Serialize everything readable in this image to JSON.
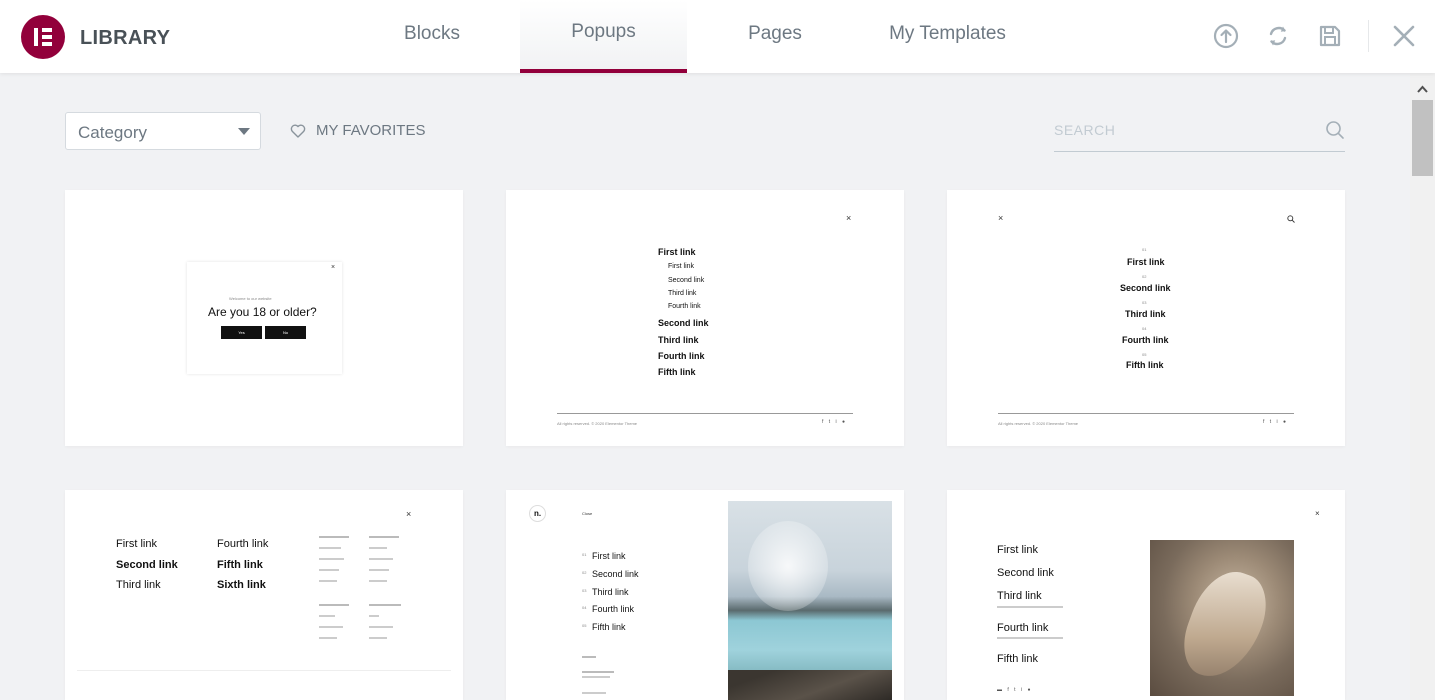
{
  "header": {
    "title": "LIBRARY",
    "tabs": [
      {
        "label": "Blocks",
        "active": false
      },
      {
        "label": "Popups",
        "active": true
      },
      {
        "label": "Pages",
        "active": false
      },
      {
        "label": "My Templates",
        "active": false
      }
    ],
    "icons": [
      "upload-icon",
      "sync-icon",
      "save-icon",
      "close-icon"
    ],
    "accent_color": "#92003b"
  },
  "toolbar": {
    "category_value": "Category",
    "favorites_label": "MY FAVORITES",
    "search_placeholder": "SEARCH"
  },
  "cards": {
    "c1": {
      "heading": "Are you 18 or older?",
      "subtitle": "Welcome to our website",
      "yes": "Yes",
      "no": "No"
    },
    "c2": {
      "links": [
        "First link",
        "First link",
        "Second link",
        "Third link",
        "Fourth link",
        "Second link",
        "Third link",
        "Fourth link",
        "Fifth link"
      ],
      "footer": "All rights reserved. © 2020 Elementor Theme"
    },
    "c3": {
      "numbers": [
        "01",
        "02",
        "03",
        "04",
        "05"
      ],
      "links": [
        "First link",
        "Second link",
        "Third link",
        "Fourth link",
        "Fifth link"
      ],
      "footer": "All rights reserved. © 2020 Elementor Theme"
    },
    "c4": {
      "col1": [
        "First link",
        "Second link",
        "Third link"
      ],
      "col2": [
        "Fourth link",
        "Fifth link",
        "Sixth link"
      ]
    },
    "c5": {
      "logo": "n.",
      "close": "Close",
      "numbers": [
        "01",
        "02",
        "03",
        "04",
        "05"
      ],
      "links": [
        "First link",
        "Second link",
        "Third link",
        "Fourth link",
        "Fifth link"
      ]
    },
    "c6": {
      "links": [
        "First link",
        "Second link",
        "Third link",
        "Fourth link",
        "Fifth link"
      ]
    }
  }
}
